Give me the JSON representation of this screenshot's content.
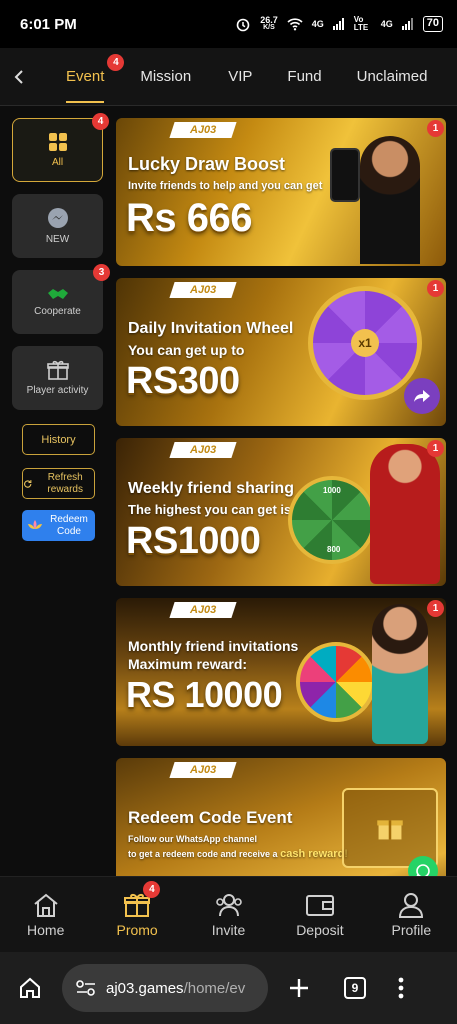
{
  "status_bar": {
    "time": "6:01 PM",
    "speed": "26.7",
    "speed_unit": "K/S",
    "net1": "4G",
    "net2": "Vo LTE",
    "net3": "4G",
    "battery": "70"
  },
  "topnav": {
    "tabs": [
      {
        "label": "Event",
        "badge": "4",
        "active": true
      },
      {
        "label": "Mission"
      },
      {
        "label": "VIP"
      },
      {
        "label": "Fund"
      },
      {
        "label": "Unclaimed"
      }
    ]
  },
  "sidebar": {
    "items": [
      {
        "label": "All",
        "badge": "4",
        "icon": "grid-icon"
      },
      {
        "label": "NEW",
        "icon": "messenger-icon"
      },
      {
        "label": "Cooperate",
        "badge": "3",
        "icon": "handshake-icon"
      },
      {
        "label": "Player activity",
        "icon": "gift-icon"
      }
    ],
    "history_label": "History",
    "refresh_label": "Refresh rewards",
    "redeem_label": "Redeem Code"
  },
  "cards": [
    {
      "logo": "AJ03",
      "title": "Lucky Draw Boost",
      "sub": "Invite friends to help and you can get",
      "amount": "Rs 666",
      "badge": "1"
    },
    {
      "logo": "AJ03",
      "title": "Daily Invitation Wheel",
      "sub": "You can get up to",
      "amount": "RS300",
      "badge": "1",
      "wheel_center": "x1"
    },
    {
      "logo": "AJ03",
      "title": "Weekly friend sharing",
      "sub": "The highest you can get is",
      "amount": "RS1000",
      "badge": "1",
      "wheel_top": "1000",
      "wheel_bottom": "800"
    },
    {
      "logo": "AJ03",
      "title": "Monthly friend invitations",
      "sub": "Maximum reward:",
      "amount": "RS 10000",
      "badge": "1"
    },
    {
      "logo": "AJ03",
      "title": "Redeem Code Event",
      "sub": "Follow our WhatsApp channel",
      "sub2": "to get a redeem code and receive a",
      "sub2_em": "cash reward!"
    }
  ],
  "bottomnav": {
    "items": [
      {
        "label": "Home",
        "icon": "home-icon"
      },
      {
        "label": "Promo",
        "icon": "gift-icon",
        "badge": "4",
        "active": true
      },
      {
        "label": "Invite",
        "icon": "people-icon"
      },
      {
        "label": "Deposit",
        "icon": "wallet-icon"
      },
      {
        "label": "Profile",
        "icon": "user-icon"
      }
    ]
  },
  "browser": {
    "url_host": "aj03.games",
    "url_path": "/home/ev",
    "tab_count": "9"
  },
  "colors": {
    "accent": "#f2c14e",
    "badge": "#e53935",
    "background": "#0d0d0d"
  }
}
